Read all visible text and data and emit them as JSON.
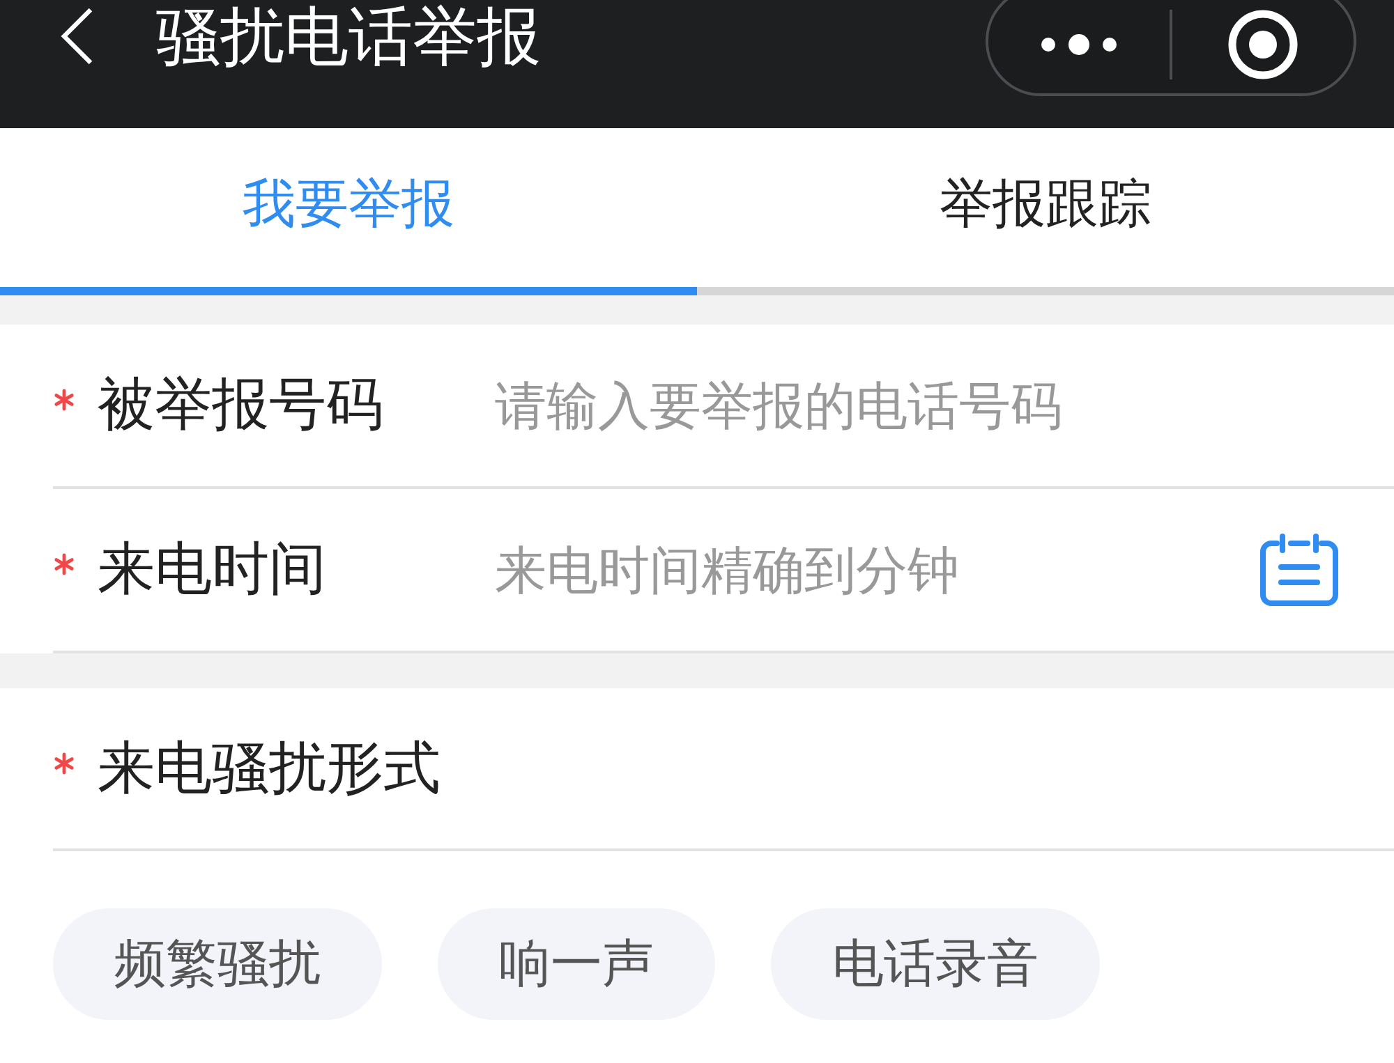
{
  "header": {
    "title": "骚扰电话举报"
  },
  "tabs": [
    {
      "label": "我要举报",
      "selected": true
    },
    {
      "label": "举报跟踪",
      "selected": false
    }
  ],
  "fields": [
    {
      "label": "被举报号码",
      "required": true,
      "placeholder": "请输入要举报的电话号码",
      "kind": "text"
    },
    {
      "label": "来电时间",
      "required": true,
      "placeholder": "来电时间精确到分钟",
      "kind": "date"
    }
  ],
  "harassment_type": {
    "label": "来电骚扰形式",
    "required": true,
    "options": [
      {
        "label": "频繁骚扰",
        "selected": false
      },
      {
        "label": "响一声",
        "selected": false
      },
      {
        "label": "电话录音",
        "selected": false
      }
    ]
  }
}
